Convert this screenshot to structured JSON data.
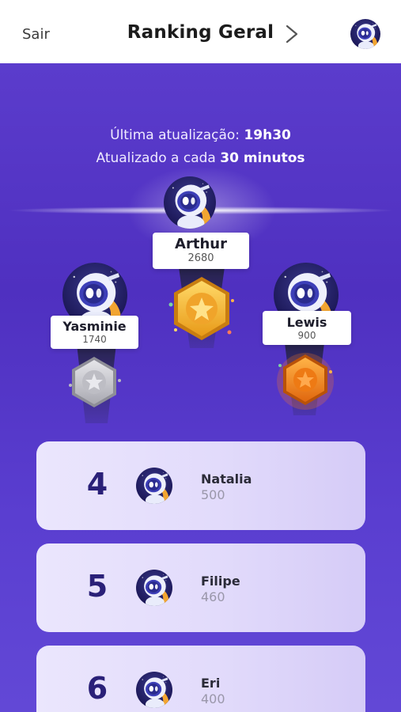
{
  "header": {
    "back_label": "Sair",
    "title": "Ranking Geral"
  },
  "update": {
    "last_label": "Última atualização: ",
    "last_time": "19h30",
    "interval_label": "Atualizado a cada ",
    "interval_value": "30 minutos"
  },
  "podium": [
    {
      "place": 2,
      "name": "Yasminie",
      "points": "1740",
      "medal": "silver"
    },
    {
      "place": 1,
      "name": "Arthur",
      "points": "2680",
      "medal": "gold"
    },
    {
      "place": 3,
      "name": "Lewis",
      "points": "900",
      "medal": "bronze"
    }
  ],
  "ranking": [
    {
      "position": "4",
      "name": "Natalia",
      "points": "500"
    },
    {
      "position": "5",
      "name": "Filipe",
      "points": "460"
    },
    {
      "position": "6",
      "name": "Eri",
      "points": "400"
    }
  ],
  "colors": {
    "background_top": "#5b3ccc",
    "background_bottom": "#6248d6",
    "gold": "#f5b531",
    "silver": "#c9c9cf",
    "bronze": "#f08a1c",
    "rank_number": "#2a2078"
  },
  "icons": {
    "forward": "chevron-right-icon",
    "avatar": "astronaut-avatar"
  }
}
